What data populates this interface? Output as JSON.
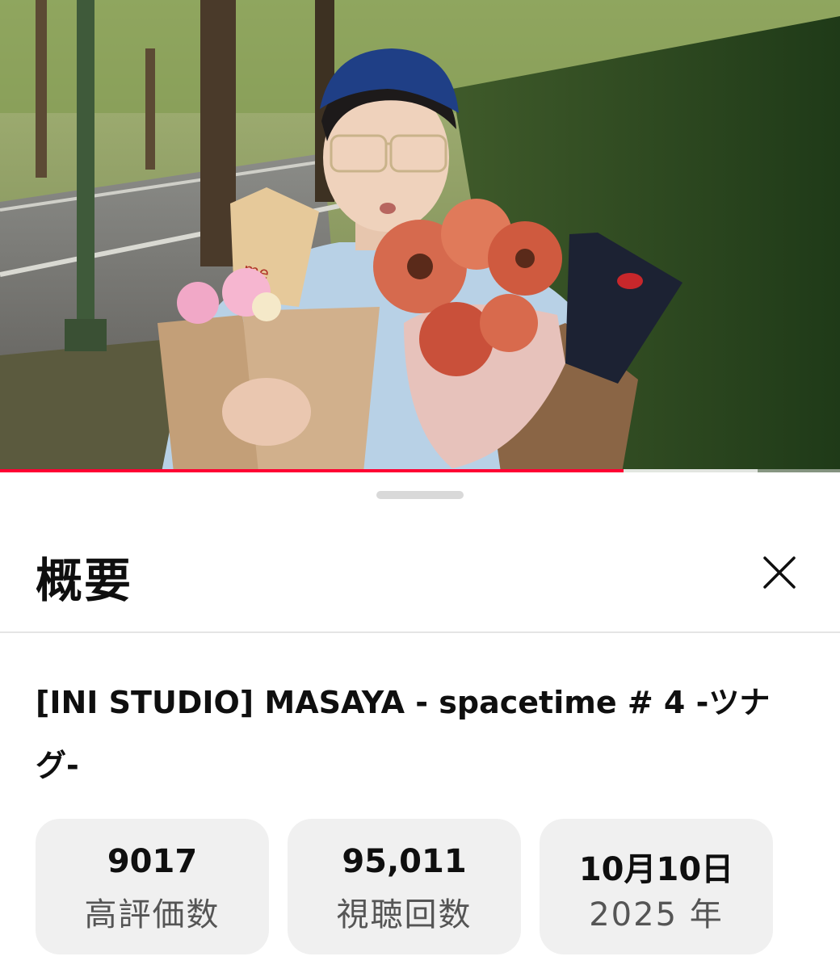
{
  "player": {
    "progress_fraction": 0.742,
    "buffer_fraction": 0.902,
    "progress_color": "#ff0033"
  },
  "sheet": {
    "title": "概要",
    "close_icon": "close-icon"
  },
  "video": {
    "title": "[INI STUDIO] MASAYA - spacetime # 4 -ツナグ-"
  },
  "stats": [
    {
      "value": "9017",
      "label": "高評価数"
    },
    {
      "value": "95,011",
      "label": "視聴回数"
    },
    {
      "value": "10月10日",
      "label": "2025 年"
    }
  ]
}
